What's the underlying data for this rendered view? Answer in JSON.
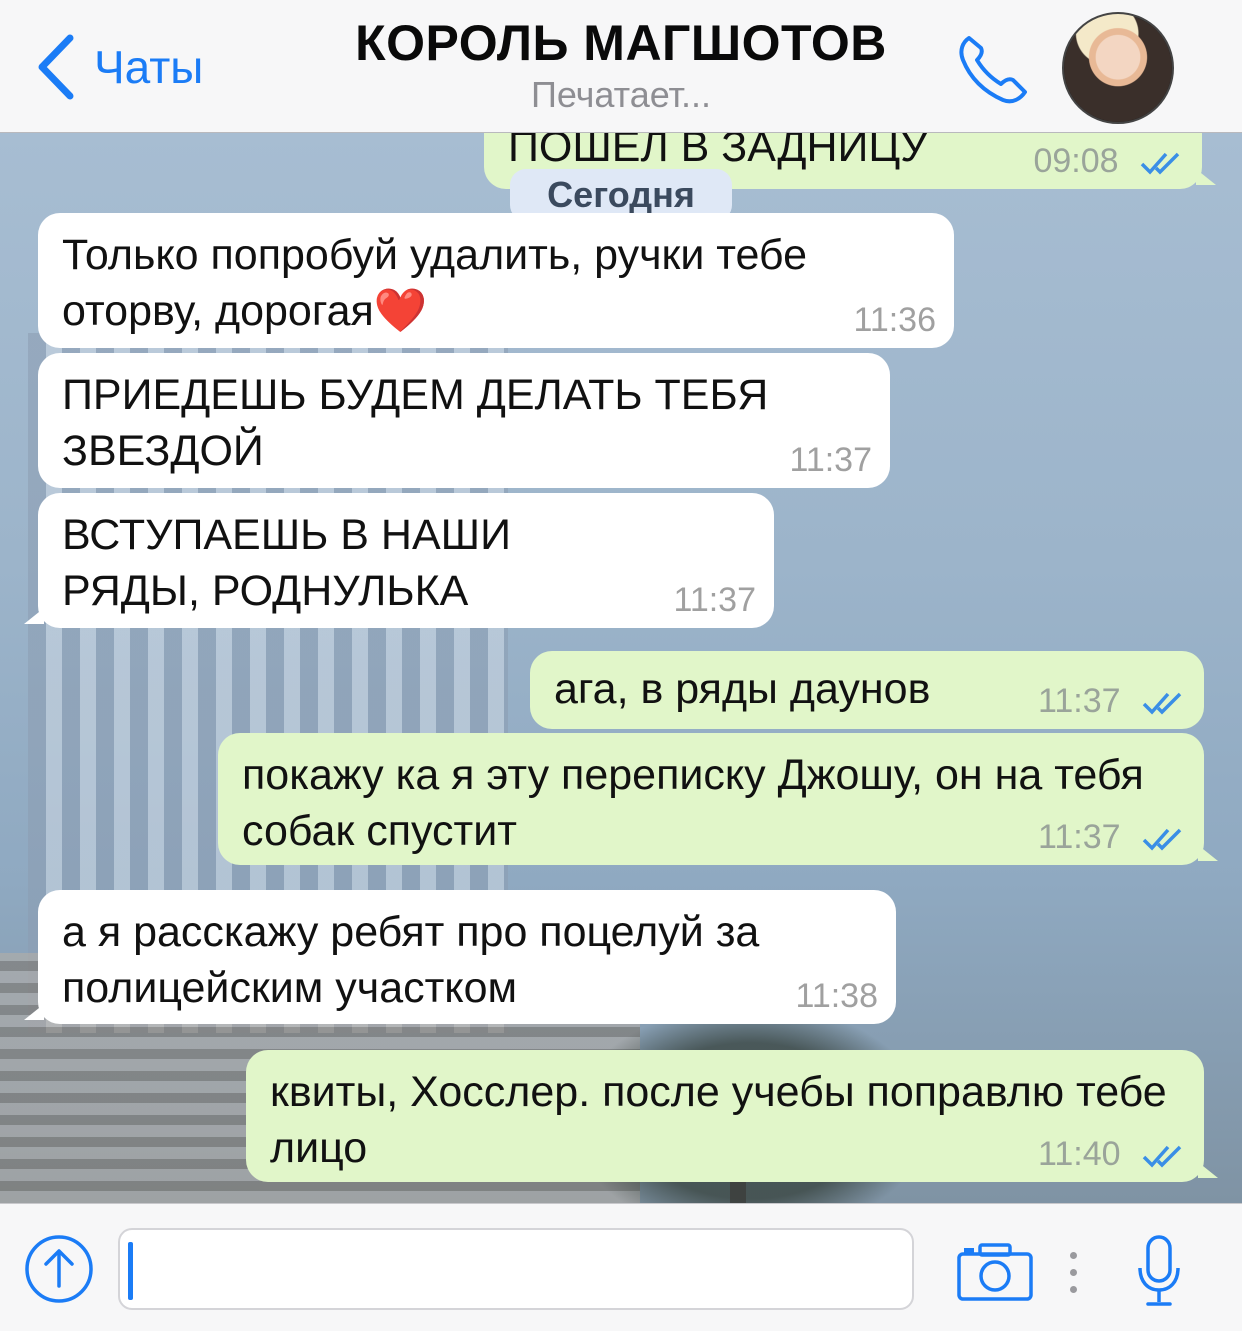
{
  "header": {
    "back_label": "Чаты",
    "title": "КОРОЛЬ МАГШОТОВ",
    "status": "Печатает..."
  },
  "date_chip": "Сегодня",
  "messages": [
    {
      "direction": "out",
      "text": "ПОШЕЛ В ЗАДНИЦУ",
      "time": "09:08",
      "read": true
    },
    {
      "direction": "in",
      "text": "Только попробуй удалить, ручки тебе оторву, дорогая❤️",
      "time": "11:36"
    },
    {
      "direction": "in",
      "text": "ПРИЕДЕШЬ БУДЕМ ДЕЛАТЬ ТЕБЯ ЗВЕЗДОЙ",
      "time": "11:37"
    },
    {
      "direction": "in",
      "text": "ВСТУПАЕШЬ В НАШИ РЯДЫ, РОДНУЛЬКА",
      "time": "11:37"
    },
    {
      "direction": "out",
      "text": "ага, в ряды даунов",
      "time": "11:37",
      "read": true
    },
    {
      "direction": "out",
      "text": "покажу ка я эту переписку Джошу, он на тебя собак спустит",
      "time": "11:37",
      "read": true
    },
    {
      "direction": "in",
      "text": "а я расскажу ребят про поцелуй за полицейским участком",
      "time": "11:38"
    },
    {
      "direction": "out",
      "text": "квиты, Хосслер. после учебы поправлю тебе лицо",
      "time": "11:40",
      "read": true
    }
  ],
  "composer": {
    "value": "",
    "placeholder": ""
  },
  "colors": {
    "accent": "#1b7cf6",
    "outgoing_bubble": "#e1f6c9",
    "incoming_bubble": "#ffffff",
    "read_ticks": "#3a8ee6"
  },
  "icons": [
    "chevron-left-icon",
    "phone-icon",
    "avatar",
    "upload-icon",
    "camera-icon",
    "more-dots-icon",
    "microphone-icon",
    "double-check-icon"
  ]
}
